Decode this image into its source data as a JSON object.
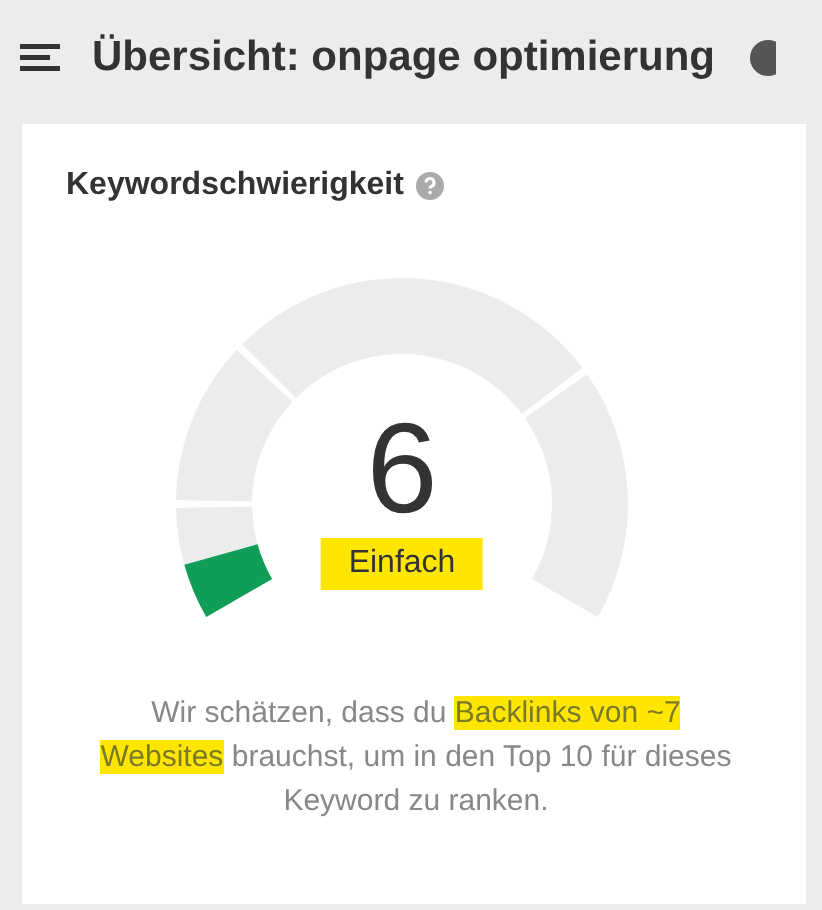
{
  "header": {
    "title": "Übersicht: onpage optimierung"
  },
  "card": {
    "title": "Keywordschwierigkeit",
    "gauge": {
      "value": "6",
      "rating": "Einfach"
    },
    "description": [
      {
        "text": "Wir schätzen, dass du ",
        "highlighted": false
      },
      {
        "text": "Backlinks von ~7 Websites",
        "highlighted": true
      },
      {
        "text": " brauchst, um in den Top 10 für dieses Keyword zu ranken.",
        "highlighted": false
      }
    ]
  }
}
